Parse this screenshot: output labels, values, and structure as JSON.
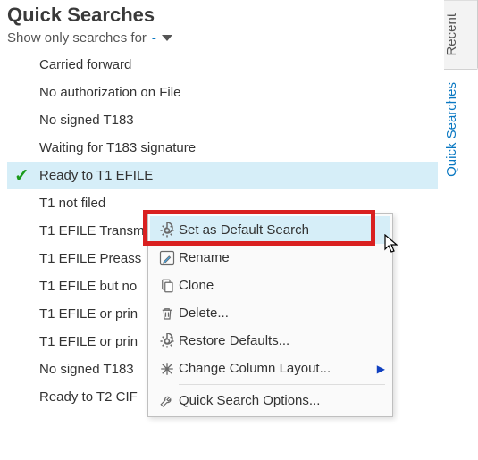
{
  "header": {
    "title": "Quick Searches",
    "filter_label": "Show only searches for",
    "filter_value": "-"
  },
  "list": {
    "items": [
      {
        "label": "Carried forward",
        "checked": false,
        "selected": false
      },
      {
        "label": "No authorization on File",
        "checked": false,
        "selected": false
      },
      {
        "label": "No signed T183",
        "checked": false,
        "selected": false
      },
      {
        "label": "Waiting for T183 signature",
        "checked": false,
        "selected": false
      },
      {
        "label": "Ready to T1 EFILE",
        "checked": true,
        "selected": true
      },
      {
        "label": "T1 not filed",
        "checked": false,
        "selected": false
      },
      {
        "label": "T1 EFILE Transm",
        "checked": false,
        "selected": false
      },
      {
        "label": "T1 EFILE Preass",
        "checked": false,
        "selected": false
      },
      {
        "label": "T1 EFILE but no",
        "checked": false,
        "selected": false
      },
      {
        "label": "T1 EFILE or prin",
        "checked": false,
        "selected": false
      },
      {
        "label": "T1 EFILE or prin",
        "checked": false,
        "selected": false
      },
      {
        "label": "No signed T183",
        "checked": false,
        "selected": false
      },
      {
        "label": "Ready to T2 CIF",
        "checked": false,
        "selected": false
      }
    ]
  },
  "side_tabs": {
    "items": [
      {
        "label": "Recent",
        "active": false
      },
      {
        "label": "Quick Searches",
        "active": true
      }
    ]
  },
  "context_menu": {
    "items": [
      {
        "icon": "gear-icon",
        "label": "Set as Default Search",
        "hovered": true
      },
      {
        "icon": "pencil-icon",
        "label": "Rename"
      },
      {
        "icon": "copy-icon",
        "label": "Clone"
      },
      {
        "icon": "trash-icon",
        "label": "Delete..."
      },
      {
        "icon": "gear-small-icon",
        "label": "Restore Defaults..."
      },
      {
        "icon": "asterisk-icon",
        "label": "Change Column Layout...",
        "submenu": true
      },
      {
        "sep": true
      },
      {
        "icon": "wrench-icon",
        "label": "Quick Search Options..."
      }
    ]
  }
}
